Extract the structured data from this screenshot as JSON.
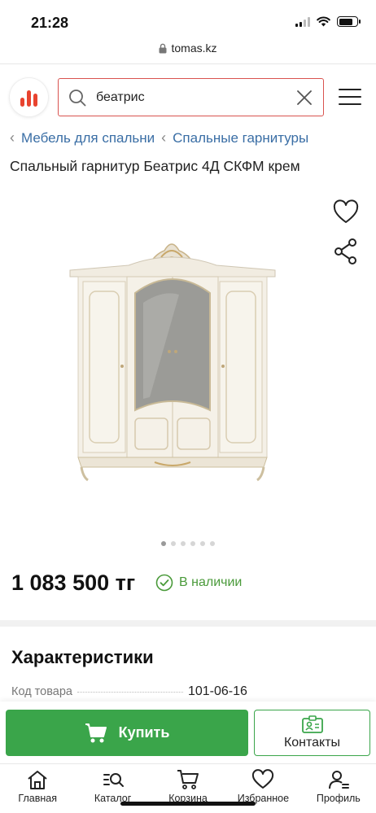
{
  "status_bar": {
    "time": "21:28",
    "signal_bars": 4,
    "signal_active": 2,
    "battery_level": 0.8,
    "icons": [
      "cellular-signal-icon",
      "wifi-icon",
      "battery-icon"
    ]
  },
  "browser": {
    "url": "tomas.kz",
    "lock_icon": "lock-icon"
  },
  "header": {
    "logo_icon": "tomas-logo-icon",
    "logo_color": "#e8432f",
    "search": {
      "value": "беатрис",
      "placeholder": "",
      "border_color": "#d9534f",
      "search_icon": "search-icon",
      "clear_icon": "close-icon"
    },
    "menu_icon": "hamburger-menu-icon"
  },
  "breadcrumb": {
    "items": [
      {
        "label": "Мебель для спальни"
      },
      {
        "label": "Спальные гарнитуры"
      }
    ],
    "link_color": "#3a6ea5"
  },
  "product": {
    "title": "Спальный гарнитур Беатрис 4Д СКФМ крем",
    "image_alt_icon": "wardrobe-image",
    "favorite_icon": "heart-icon",
    "share_icon": "share-icon",
    "gallery": {
      "total": 6,
      "active": 1
    },
    "price": "1 083 500 тг",
    "availability": "В наличии",
    "availability_icon": "check-circle-icon",
    "availability_color": "#4a9a3a"
  },
  "characteristics": {
    "title": "Характеристики",
    "rows": [
      {
        "label": "Код товара",
        "value": "101-06-16"
      }
    ]
  },
  "actions": {
    "buy_label": "Купить",
    "buy_icon": "cart-icon",
    "buy_color": "#3aa54a",
    "contacts_label": "Контакты",
    "contacts_icon": "contact-card-icon"
  },
  "bottom_nav": {
    "items": [
      {
        "label": "Главная",
        "icon": "home-icon"
      },
      {
        "label": "Каталог",
        "icon": "catalog-search-icon"
      },
      {
        "label": "Корзина",
        "icon": "cart-icon"
      },
      {
        "label": "Избранное",
        "icon": "heart-icon"
      },
      {
        "label": "Профиль",
        "icon": "profile-icon"
      }
    ]
  }
}
